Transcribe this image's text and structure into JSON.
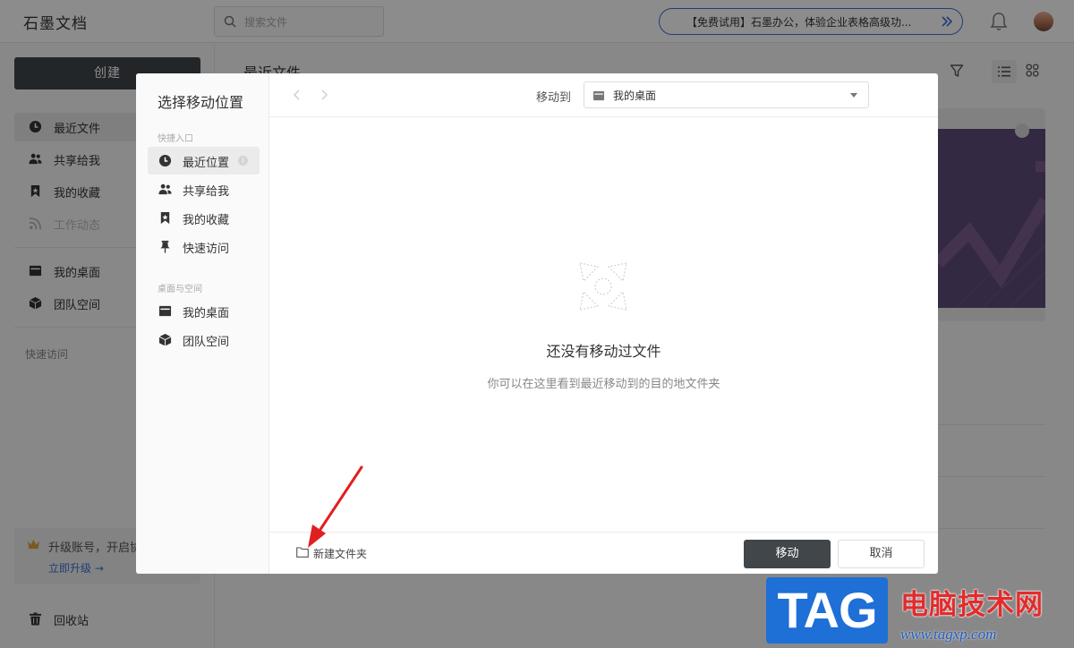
{
  "app": {
    "logo": "石墨文档",
    "search_placeholder": "搜索文件",
    "promo_text": "【免费试用】石墨办公，体验企业表格高级功..."
  },
  "sidebar": {
    "create_label": "创建",
    "items": [
      {
        "label": "最近文件",
        "icon": "clock-icon"
      },
      {
        "label": "共享给我",
        "icon": "users-icon"
      },
      {
        "label": "我的收藏",
        "icon": "bookmark-icon"
      },
      {
        "label": "工作动态",
        "icon": "rss-icon"
      }
    ],
    "spaces": [
      {
        "label": "我的桌面",
        "icon": "desktop-icon"
      },
      {
        "label": "团队空间",
        "icon": "cube-icon"
      }
    ],
    "quick_access_caption": "快速访问",
    "upgrade_text": "升级账号，开启协",
    "upgrade_link": "立即升级 →",
    "trash_label": "回收站"
  },
  "main": {
    "title": "最近文件"
  },
  "modal": {
    "title": "选择移动位置",
    "quick_caption": "快捷入口",
    "quick_items": [
      {
        "label": "最近位置",
        "icon": "clock-icon",
        "active": true
      },
      {
        "label": "共享给我",
        "icon": "users-icon"
      },
      {
        "label": "我的收藏",
        "icon": "bookmark-icon"
      },
      {
        "label": "快速访问",
        "icon": "pin-icon"
      }
    ],
    "space_caption": "桌面与空间",
    "space_items": [
      {
        "label": "我的桌面",
        "icon": "desktop-icon"
      },
      {
        "label": "团队空间",
        "icon": "cube-icon"
      }
    ],
    "move_to_label": "移动到",
    "location_value": "我的桌面",
    "empty_title": "还没有移动过文件",
    "empty_subtitle": "你可以在这里看到最近移动到的目的地文件夹",
    "new_folder_label": "新建文件夹",
    "move_button": "移动",
    "cancel_button": "取消"
  },
  "watermark": {
    "tag": "TAG",
    "cn": "电脑技术网",
    "url": "www.tagxp.com"
  },
  "colors": {
    "primary_button": "#41464b",
    "promo_border": "#3d6fd6",
    "annotation_arrow": "#e02020"
  }
}
